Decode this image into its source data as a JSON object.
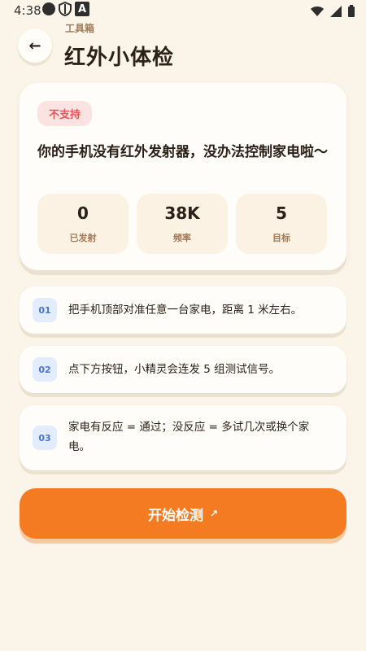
{
  "status_bar": {
    "time": "4:38",
    "notification_letter": "A"
  },
  "header": {
    "breadcrumb": "工具箱",
    "title": "红外小体检",
    "back_icon": "←"
  },
  "status_card": {
    "badge": "不支持",
    "message": "你的手机没有红外发射器，没办法控制家电啦〜",
    "stats": [
      {
        "value": "0",
        "label": "已发射"
      },
      {
        "value": "38K",
        "label": "频率"
      },
      {
        "value": "5",
        "label": "目标"
      }
    ]
  },
  "steps": [
    {
      "num": "01",
      "text": "把手机顶部对准任意一台家电，距离 1 米左右。"
    },
    {
      "num": "02",
      "text": "点下方按钮，小精灵会连发 5 组测试信号。"
    },
    {
      "num": "03",
      "text": "家电有反应 = 通过；没反应 = 多试几次或换个家电。"
    }
  ],
  "start_button": {
    "label": "开始检测",
    "icon": "↗"
  },
  "colors": {
    "background": "#fbf4e8",
    "accent": "#f57b22",
    "badge_text": "#e25858",
    "badge_bg": "#fbe3e2",
    "step_num_text": "#4a73c7"
  }
}
